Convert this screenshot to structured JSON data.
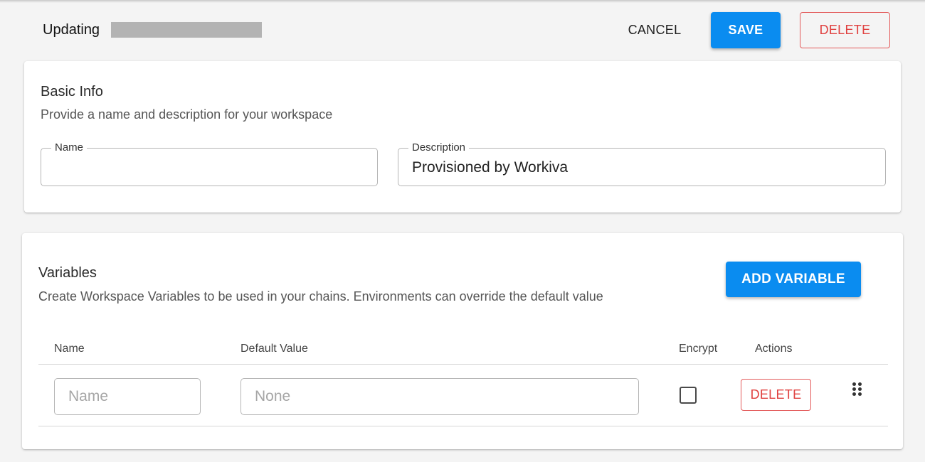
{
  "header": {
    "title": "Updating",
    "cancel_label": "CANCEL",
    "save_label": "SAVE",
    "delete_label": "DELETE"
  },
  "basic_info": {
    "title": "Basic Info",
    "subtitle": "Provide a name and description for your workspace",
    "name_label": "Name",
    "name_value": "",
    "description_label": "Description",
    "description_value": "Provisioned by Workiva"
  },
  "variables": {
    "title": "Variables",
    "subtitle": "Create Workspace Variables to be used in your chains. Environments can override the default value",
    "add_label": "ADD VARIABLE",
    "columns": [
      "Name",
      "Default Value",
      "Encrypt",
      "Actions"
    ],
    "rows": [
      {
        "name_value": "",
        "name_placeholder": "Name",
        "default_value": "",
        "default_placeholder": "None",
        "encrypt": false,
        "delete_label": "DELETE"
      }
    ]
  },
  "colors": {
    "primary": "#0a8cf0",
    "danger": "#e0403f",
    "background": "#f4f4f4"
  },
  "icons": [
    "drag-handle-icon",
    "checkbox-unchecked"
  ]
}
